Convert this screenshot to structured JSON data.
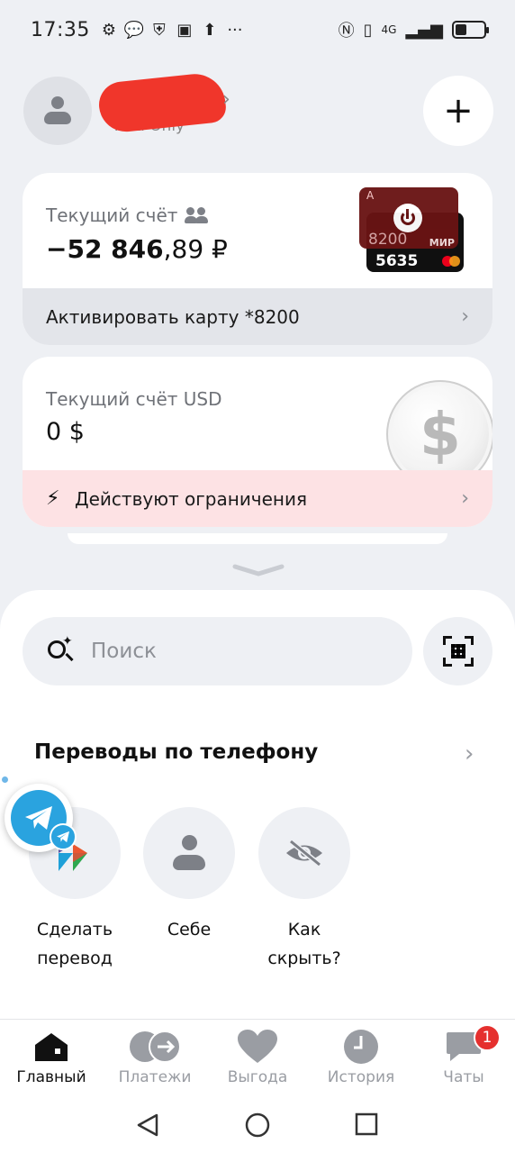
{
  "status_bar": {
    "time": "17:35",
    "network": "4G",
    "more": "···"
  },
  "header": {
    "subtitle": "Alfa Only",
    "add_button_label": "+"
  },
  "accounts": [
    {
      "title": "Текущий счёт",
      "balance_int": "−52 846",
      "balance_frac": ",89 ₽",
      "card_front_number": "8200",
      "card_front_brand": "МИР",
      "card_front_bank": "А",
      "card_back_number": "5635",
      "action": "Активировать карту *8200"
    },
    {
      "title": "Текущий счёт USD",
      "balance": "0 $",
      "coin_symbol": "$",
      "action": "Действуют ограничения"
    }
  ],
  "search": {
    "placeholder": "Поиск"
  },
  "transfers": {
    "title": "Переводы по телефону",
    "actions": [
      {
        "label_line1": "Сделать",
        "label_line2": "перевод"
      },
      {
        "label_line1": "Себе",
        "label_line2": ""
      },
      {
        "label_line1": "Как",
        "label_line2": "скрыть?"
      }
    ]
  },
  "tabs": [
    {
      "label": "Главный",
      "active": true
    },
    {
      "label": "Платежи",
      "active": false
    },
    {
      "label": "Выгода",
      "active": false
    },
    {
      "label": "История",
      "active": false
    },
    {
      "label": "Чаты",
      "active": false,
      "badge": "1"
    }
  ],
  "colors": {
    "background": "#eef0f4",
    "alert_bg": "#fde2e4",
    "badge": "#e5302e",
    "redaction": "#f0362b",
    "telegram": "#2aa3df"
  }
}
